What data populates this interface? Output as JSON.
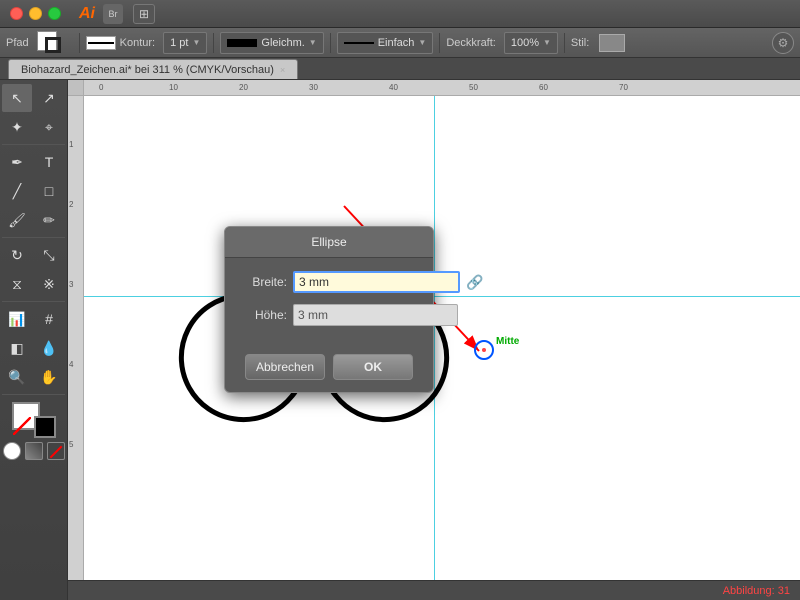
{
  "app": {
    "title": "Ai",
    "logo": "Ai"
  },
  "titlebar": {
    "traffic_lights": [
      "red",
      "yellow",
      "green"
    ],
    "icon_label": "Br",
    "icon2_label": "⊞"
  },
  "toolbar": {
    "pfad_label": "Pfad",
    "kontur_label": "Kontur:",
    "pt_label": "1 pt",
    "gleichm_label": "Gleichm.",
    "einfach_label": "Einfach",
    "deckkraft_label": "Deckkraft:",
    "deckkraft_value": "100%",
    "stil_label": "Stil:"
  },
  "tab": {
    "close_symbol": "×",
    "title": "Biohazard_Zeichen.ai* bei 311 % (CMYK/Vorschau)"
  },
  "dialog": {
    "title": "Ellipse",
    "breite_label": "Breite:",
    "breite_value": "3 mm",
    "hoehe_label": "Höhe:",
    "hoehe_value": "3 mm",
    "cancel_label": "Abbrechen",
    "ok_label": "OK",
    "lock_symbol": "🔗"
  },
  "cursor": {
    "mitte_label": "Mitte"
  },
  "statusbar": {
    "abbildung_text": "Abbildung: 31"
  },
  "ruler": {
    "h_ticks": [
      "0",
      "10",
      "20",
      "30",
      "40",
      "50",
      "60",
      "70"
    ],
    "v_ticks": [
      "1",
      "2",
      "3",
      "4",
      "5"
    ]
  }
}
